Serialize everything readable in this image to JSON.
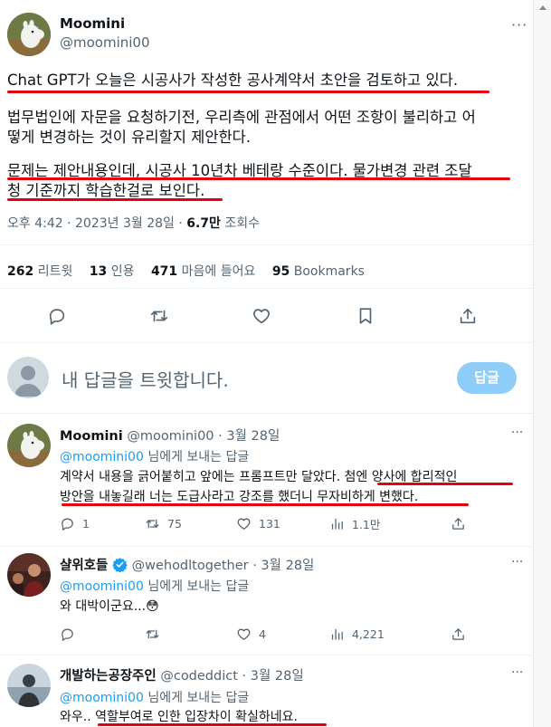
{
  "tweet": {
    "author_name": "Moomini",
    "author_handle": "@moomini00",
    "line1": "Chat GPT가 오늘은 시공사가 작성한 공사계약서 초안을 검토하고 있다.",
    "line2": "법무법인에 자문을 요청하기전, 우리측에 관점에서 어떤 조항이 불리하고 어",
    "line3": "떻게 변경하는 것이 유리할지 제안한다.",
    "line4": "문제는 제안내용인데, 시공사 10년차 베테랑 수준이다. 물가변경 관련 조달",
    "line5": "청 기준까지 학습한걸로 보인다.",
    "time": "오후 4:42 · 2023년 3월 28일 · ",
    "views_count": "6.7만",
    "views_label": " 조회수"
  },
  "stats": {
    "retweets_count": "262",
    "retweets_label": "리트윗",
    "quotes_count": "13",
    "quotes_label": "인용",
    "likes_count": "471",
    "likes_label": "마음에 들어요",
    "bookmarks_count": "95",
    "bookmarks_label": "Bookmarks"
  },
  "icons": {
    "reply": "reply-icon",
    "retweet": "retweet-icon",
    "like": "heart-icon",
    "bookmark": "bookmark-icon",
    "share": "share-icon",
    "views": "views-icon",
    "verified": "verified-badge-icon"
  },
  "compose": {
    "placeholder": "내 답글을 트윗합니다.",
    "button_label": "답글"
  },
  "replies": [
    {
      "name": "Moomini",
      "handle": "@moomini00",
      "date": " · 3월 28일",
      "to_mention": "@moomini00",
      "to_suffix": " 님에게 보내는 답글",
      "text1": "계약서 내용을 긁어붙히고 앞에는 프롬프트만 달았다. 첨엔 양사에 합리적인",
      "text2": "방안을 내놓길래 너는 도급사라고 강조를 했더니 무자비하게 변했다.",
      "replies": "1",
      "retweets": "75",
      "likes": "131",
      "views": "1.1만"
    },
    {
      "name": "샬위호들",
      "handle": "@wehodltogether",
      "date": " · 3월 28일",
      "to_mention": "@moomini00",
      "to_suffix": " 님에게 보내는 답글",
      "text1": "와 대박이군요...😳",
      "replies": "",
      "retweets": "",
      "likes": "4",
      "views": "4,221"
    },
    {
      "name": "개발하는공장주인",
      "handle": "@codeddict",
      "date": " · 3월 28일",
      "to_mention": "@moomini00",
      "to_suffix": " 님에게 보내는 답글",
      "text1": "와우.. 역할부여로 인한 입장차이 확실하네요."
    }
  ],
  "colors": {
    "accent": "#1d9bf0",
    "underline": "#e4000f",
    "reply_button": "#8ecdf8",
    "secondary_text": "#536471"
  }
}
